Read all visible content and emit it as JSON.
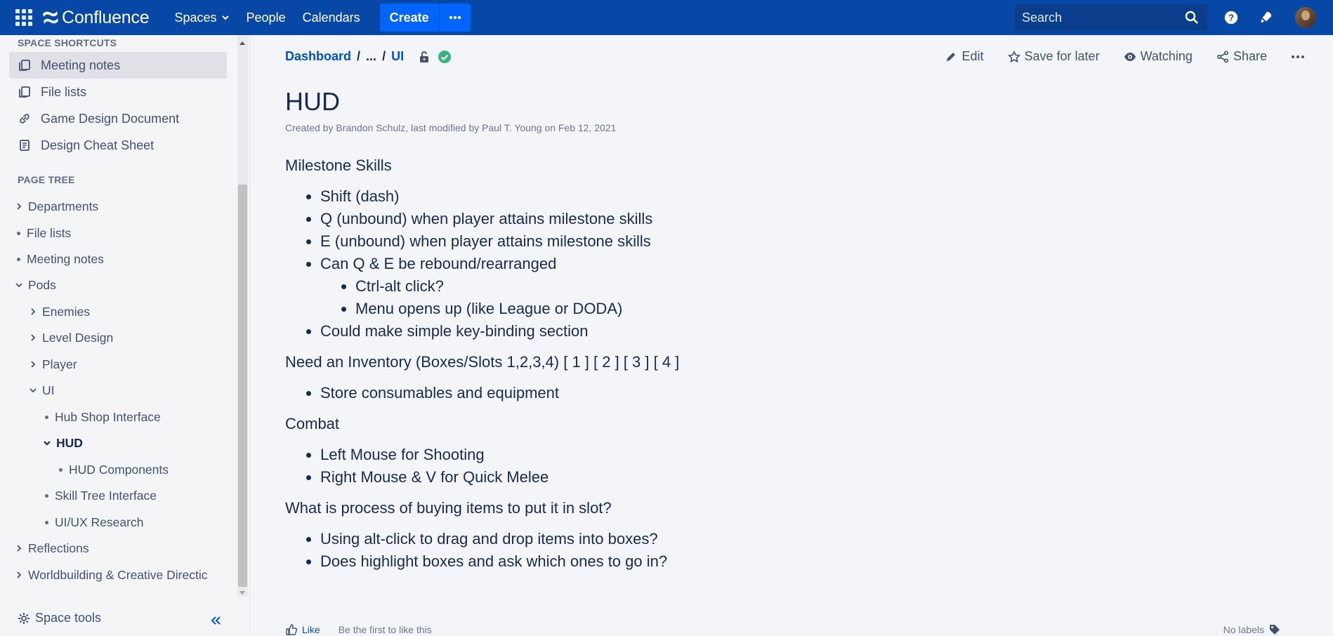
{
  "app": {
    "name": "Confluence",
    "colors": {
      "header_bg": "#0747a6",
      "create_bg": "#0065ff",
      "link": "#0052cc",
      "success": "#36b37e"
    }
  },
  "topbar": {
    "nav": [
      "Spaces",
      "People",
      "Calendars"
    ],
    "create_label": "Create",
    "search_placeholder": "Search",
    "icons": [
      "app-switcher-icon",
      "confluence-logo-icon",
      "more-dots-icon",
      "search-icon",
      "help-icon",
      "notifications-icon",
      "avatar"
    ]
  },
  "sidebar": {
    "shortcuts_heading": "SPACE SHORTCUTS",
    "shortcuts": [
      {
        "label": "Meeting notes",
        "icon": "copy-icon",
        "active": true
      },
      {
        "label": "File lists",
        "icon": "copy-icon",
        "active": false
      },
      {
        "label": "Game Design Document",
        "icon": "link-icon",
        "active": false
      },
      {
        "label": "Design Cheat Sheet",
        "icon": "document-icon",
        "active": false
      }
    ],
    "tree_heading": "PAGE TREE",
    "tree": [
      {
        "label": "Departments",
        "level": 0,
        "state": "collapsed"
      },
      {
        "label": "File lists",
        "level": 0,
        "state": "leaf"
      },
      {
        "label": "Meeting notes",
        "level": 0,
        "state": "leaf"
      },
      {
        "label": "Pods",
        "level": 0,
        "state": "expanded"
      },
      {
        "label": "Enemies",
        "level": 1,
        "state": "collapsed"
      },
      {
        "label": "Level Design",
        "level": 1,
        "state": "collapsed"
      },
      {
        "label": "Player",
        "level": 1,
        "state": "collapsed"
      },
      {
        "label": "UI",
        "level": 1,
        "state": "expanded"
      },
      {
        "label": "Hub Shop Interface",
        "level": 2,
        "state": "leaf"
      },
      {
        "label": "HUD",
        "level": 2,
        "state": "expanded",
        "current": true
      },
      {
        "label": "HUD Components",
        "level": 3,
        "state": "leaf"
      },
      {
        "label": "Skill Tree Interface",
        "level": 2,
        "state": "leaf"
      },
      {
        "label": "UI/UX Research",
        "level": 2,
        "state": "leaf"
      },
      {
        "label": "Reflections",
        "level": 0,
        "state": "collapsed"
      },
      {
        "label": "Worldbuilding & Creative Directic",
        "level": 0,
        "state": "collapsed"
      }
    ],
    "space_tools_label": "Space tools"
  },
  "breadcrumb": {
    "root": "Dashboard",
    "ellipsis": "...",
    "parent": "UI"
  },
  "page_actions": [
    {
      "label": "Edit",
      "icon": "pencil-icon"
    },
    {
      "label": "Save for later",
      "icon": "star-icon"
    },
    {
      "label": "Watching",
      "icon": "eye-icon"
    },
    {
      "label": "Share",
      "icon": "share-icon"
    }
  ],
  "page": {
    "title": "HUD",
    "byline": "Created by Brandon Schulz, last modified by Paul T. Young on Feb 12, 2021",
    "sections": [
      {
        "heading": "Milestone Skills",
        "items": [
          {
            "text": "Shift (dash)"
          },
          {
            "text": "Q (unbound) when player attains milestone skills"
          },
          {
            "text": "E (unbound) when player attains milestone skills"
          },
          {
            "text": "Can Q & E be rebound/rearranged",
            "children": [
              "Ctrl-alt click?",
              "Menu opens up (like League or DODA)"
            ]
          },
          {
            "text": "Could make simple key-binding section"
          }
        ]
      },
      {
        "heading": "Need an Inventory (Boxes/Slots 1,2,3,4) [ 1 ] [ 2 ] [ 3 ] [ 4 ]",
        "items": [
          {
            "text": "Store consumables and equipment"
          }
        ]
      },
      {
        "heading": "Combat",
        "items": [
          {
            "text": "Left Mouse for Shooting"
          },
          {
            "text": "Right Mouse & V for Quick Melee"
          }
        ]
      },
      {
        "heading": "What is process of buying items to put it in slot?",
        "items": [
          {
            "text": "Using alt-click to drag and drop items into boxes?"
          },
          {
            "text": "Does highlight boxes and ask which ones to go in?"
          }
        ]
      }
    ]
  },
  "footer": {
    "like_label": "Like",
    "like_hint": "Be the first to like this",
    "labels_text": "No labels"
  }
}
